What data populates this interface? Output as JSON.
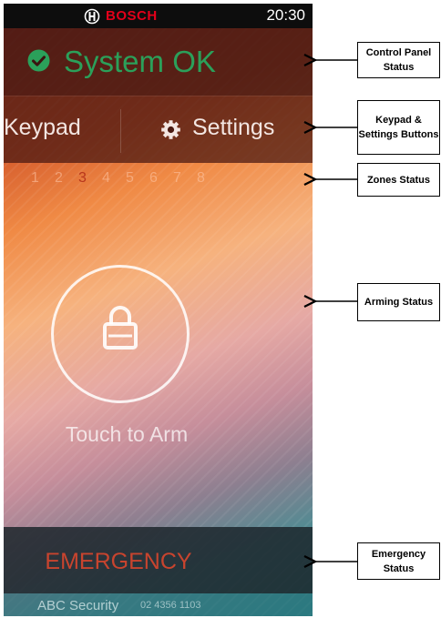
{
  "status_bar": {
    "brand": "BOSCH",
    "time": "20:30"
  },
  "control_panel": {
    "status_text": "System OK",
    "status_color": "#2ba05a"
  },
  "buttons": {
    "keypad_label": "Keypad",
    "settings_label": "Settings"
  },
  "zones": {
    "labels": [
      "1",
      "2",
      "3",
      "4",
      "5",
      "6",
      "7",
      "8"
    ],
    "active_zone": "3"
  },
  "arming": {
    "label": "Touch to Arm",
    "icon": "lock-icon"
  },
  "emergency": {
    "label": "EMERGENCY",
    "color": "#c8442e"
  },
  "footer": {
    "company": "ABC Security",
    "phone": "02 4356 1103"
  },
  "annotations": [
    {
      "text": "Control Panel Status"
    },
    {
      "text": "Keypad & Settings Buttons"
    },
    {
      "text": "Zones Status"
    },
    {
      "text": "Arming Status"
    },
    {
      "text": "Emergency Status"
    }
  ]
}
